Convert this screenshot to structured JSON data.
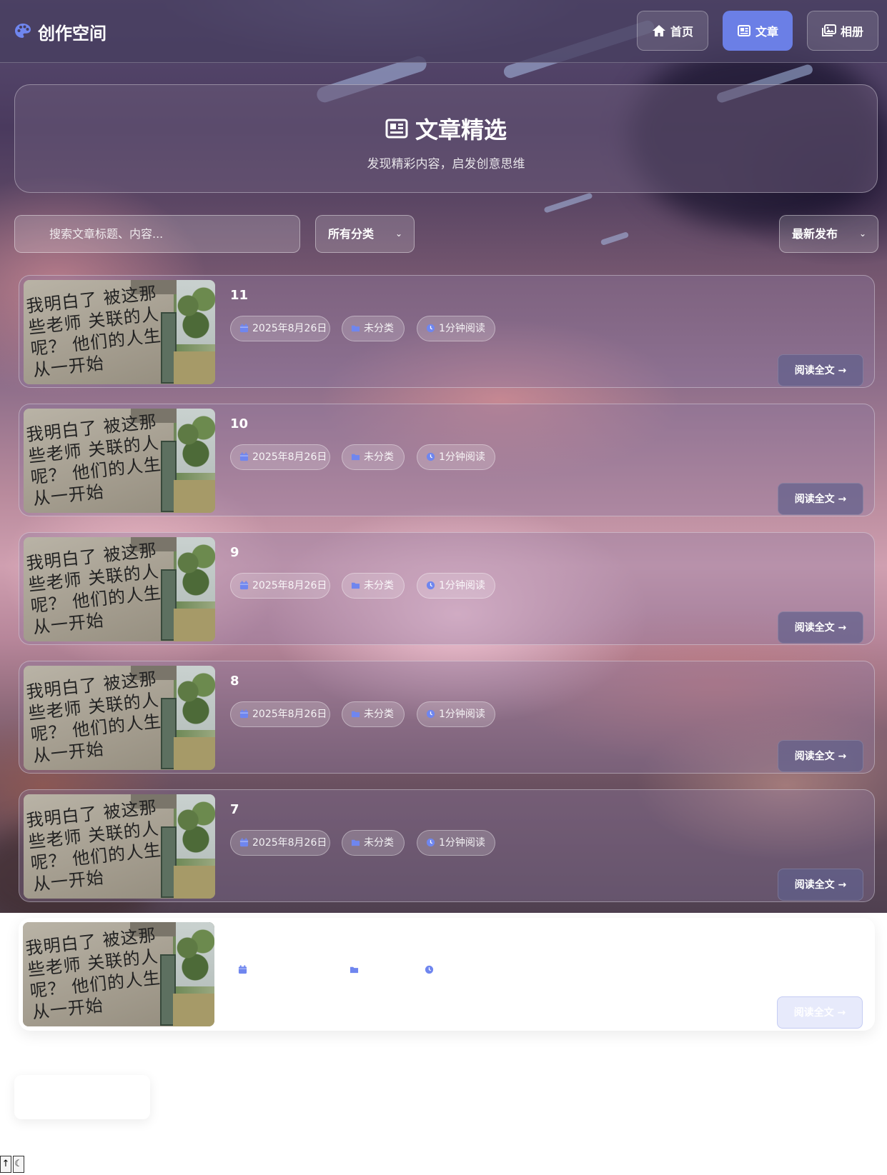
{
  "navbar": {
    "brand": "创作空间",
    "links": [
      {
        "label": "首页",
        "icon": "home-icon",
        "active": false
      },
      {
        "label": "文章",
        "icon": "newspaper-icon",
        "active": true
      },
      {
        "label": "相册",
        "icon": "images-icon",
        "active": false
      }
    ]
  },
  "hero": {
    "title": "文章精选",
    "subtitle": "发现精彩内容，启发创意思维"
  },
  "filters": {
    "search_placeholder": "搜索文章标题、内容...",
    "category_selected": "所有分类",
    "sort_selected": "最新发布"
  },
  "articles": [
    {
      "title": "11",
      "date": "2025年8月26日",
      "category": "未分类",
      "read_time": "1分钟阅读",
      "button": "阅读全文 →",
      "image_text": "我明白了 被这那些老师 关联的人呢？ 他们的人生从一开始"
    },
    {
      "title": "10",
      "date": "2025年8月26日",
      "category": "未分类",
      "read_time": "1分钟阅读",
      "button": "阅读全文 →",
      "image_text": "我明白了 被这那些老师 关联的人呢？ 他们的人生从一开始"
    },
    {
      "title": "9",
      "date": "2025年8月26日",
      "category": "未分类",
      "read_time": "1分钟阅读",
      "button": "阅读全文 →",
      "image_text": "我明白了 被这那些老师 关联的人呢？ 他们的人生从一开始"
    },
    {
      "title": "8",
      "date": "2025年8月26日",
      "category": "未分类",
      "read_time": "1分钟阅读",
      "button": "阅读全文 →",
      "image_text": "我明白了 被这那些老师 关联的人呢？ 他们的人生从一开始"
    },
    {
      "title": "7",
      "date": "2025年8月26日",
      "category": "未分类",
      "read_time": "1分钟阅读",
      "button": "阅读全文 →",
      "image_text": "我明白了 被这那些老师 关联的人呢？ 他们的人生从一开始"
    },
    {
      "title": "",
      "date": "",
      "category": "",
      "read_time": "",
      "button": "阅读全文 →",
      "image_text": "我明白了 被这那些老师 关联的人呢？ 他们的人生从一开始"
    }
  ],
  "controls": {
    "back_to_top": "↑",
    "theme_toggle": "☾"
  },
  "colors": {
    "accent": "#6b7fe6",
    "icon_blue": "#6f86ef"
  }
}
